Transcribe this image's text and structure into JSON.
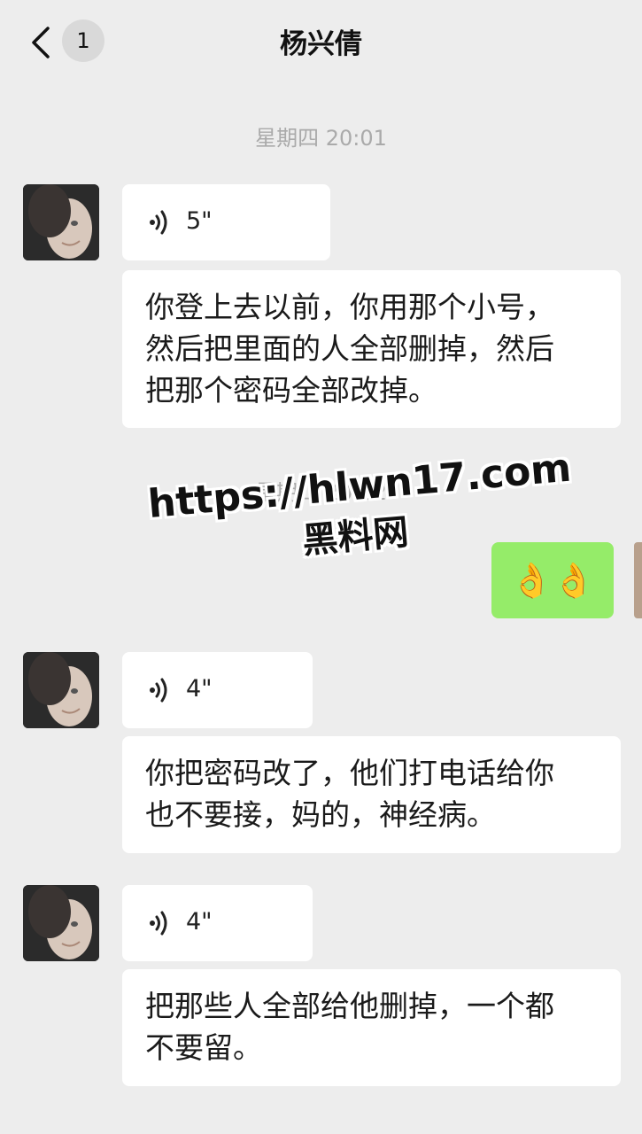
{
  "header": {
    "unread_count": "1",
    "title": "杨兴倩"
  },
  "timestamps": [
    "星期四 20:01",
    "星期四 20:02"
  ],
  "messages": [
    {
      "type": "voice",
      "duration": "5\""
    },
    {
      "type": "text",
      "text": "你登上去以前，你用那个小号，\n然后把里面的人全部删掉，然后\n把那个密码全部改掉。"
    },
    {
      "type": "emoji",
      "text": "👌👌"
    },
    {
      "type": "voice",
      "duration": "4\""
    },
    {
      "type": "text",
      "text": "你把密码改了，他们打电话给你\n也不要接，妈的，神经病。"
    },
    {
      "type": "voice",
      "duration": "4\""
    },
    {
      "type": "text",
      "text": "把那些人全部给他删掉，一个都\n不要留。"
    }
  ],
  "watermark": {
    "url": "https://hlwn17.com",
    "name": "黑料网"
  },
  "colors": {
    "background": "#ededed",
    "self_bubble": "#95ec69",
    "other_bubble": "#ffffff",
    "timestamp": "#aaaaaa"
  }
}
